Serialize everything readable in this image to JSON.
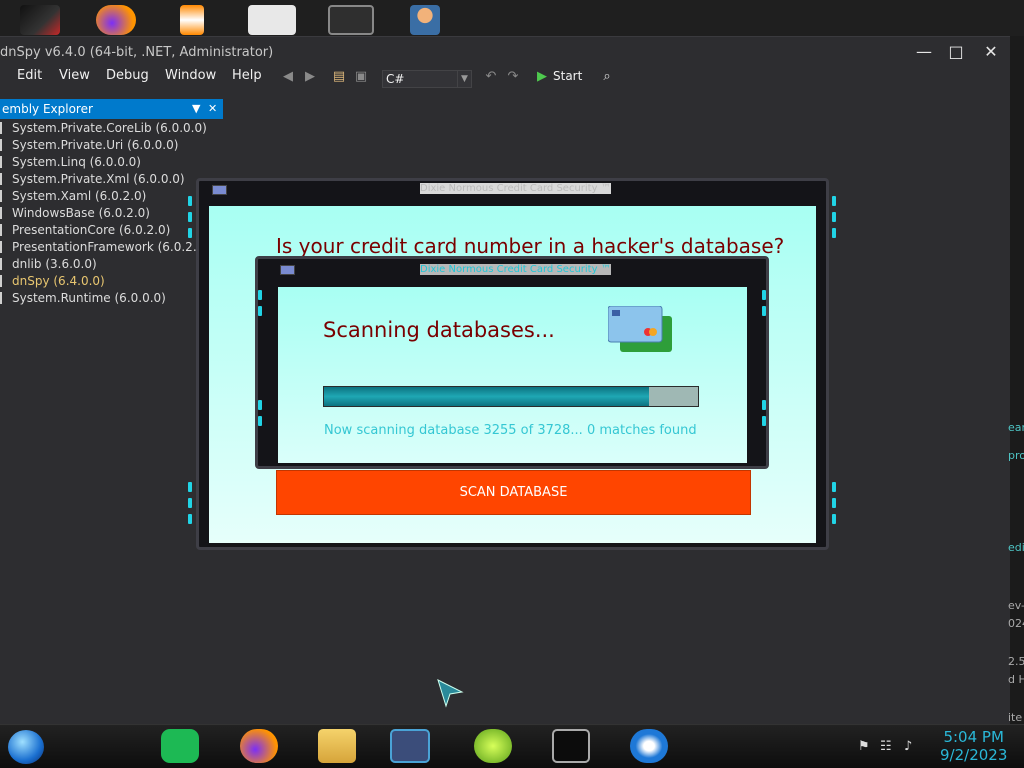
{
  "window": {
    "title": "dnSpy v6.4.0 (64-bit, .NET, Administrator)",
    "minimize_glyph": "—",
    "maximize_glyph": "□",
    "close_glyph": "✕"
  },
  "menu": [
    "Edit",
    "View",
    "Debug",
    "Window",
    "Help"
  ],
  "toolbar": {
    "language": "C#",
    "start_label": "Start"
  },
  "assembly_explorer": {
    "title": "embly Explorer",
    "items": [
      {
        "label": "System.Private.CoreLib (6.0.0.0)"
      },
      {
        "label": "System.Private.Uri (6.0.0.0)"
      },
      {
        "label": "System.Linq (6.0.0.0)"
      },
      {
        "label": "System.Private.Xml (6.0.0.0)"
      },
      {
        "label": "System.Xaml (6.0.2.0)"
      },
      {
        "label": "WindowsBase (6.0.2.0)"
      },
      {
        "label": "PresentationCore (6.0.2.0)"
      },
      {
        "label": "PresentationFramework (6.0.2.0)"
      },
      {
        "label": "dnlib (3.6.0.0)"
      },
      {
        "label": "dnSpy (6.4.0.0)"
      },
      {
        "label": "System.Runtime (6.0.0.0)"
      }
    ]
  },
  "right_edge_fragments": [
    "ean",
    "pro",
    "edit",
    "ev-",
    "024",
    "2.5",
    "d H",
    "ite"
  ],
  "popup": {
    "title": "Dixie Normous Credit Card Security ™",
    "question": "Is your credit card number in a hacker's database?",
    "scan_button": "SCAN DATABASE"
  },
  "progress_dialog": {
    "title": "Dixie Normous Credit Card Security ™",
    "heading": "Scanning databases...",
    "progress_fraction": 0.87,
    "status": "Now scanning database 3255 of 3728... 0 matches found"
  },
  "taskbar": {
    "time": "5:04 PM",
    "date": "9/2/2023"
  },
  "colors": {
    "accent": "#007acc",
    "popup_bg": "#a8fff3",
    "heading": "#7a0000",
    "scan_button": "#ff4500",
    "status_text": "#35c7d3",
    "clock": "#2ab8d8"
  }
}
